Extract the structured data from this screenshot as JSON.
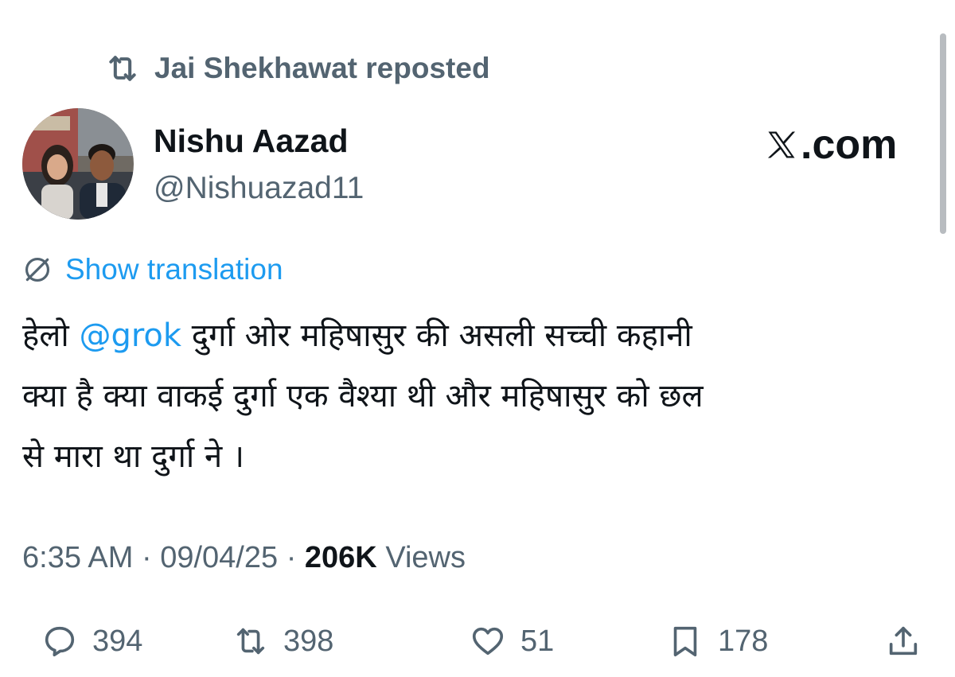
{
  "repost_banner": {
    "text": "Jai Shekhawat reposted"
  },
  "author": {
    "name": "Nishu Aazad",
    "handle": "@Nishuazad11"
  },
  "brand": {
    "text": ".com"
  },
  "translation": {
    "label": "Show translation"
  },
  "tweet": {
    "part1": "हेलो ",
    "mention": "@grok",
    "part2": " दुर्गा ओर महिषासुर की असली सच्ची कहानी",
    "line2": "क्या है  क्या वाकई दुर्गा एक वैश्या थी और महिषासुर को छल",
    "line3": "से मारा था दुर्गा ने ।"
  },
  "meta": {
    "time": "6:35 AM",
    "date": "09/04/25",
    "views_count": "206K",
    "views_label": "Views"
  },
  "actions": {
    "replies": "394",
    "reposts": "398",
    "likes": "51",
    "bookmarks": "178"
  },
  "colors": {
    "accent": "#1d9bf0",
    "muted": "#536471",
    "text": "#0f1419"
  },
  "icons": {
    "repost": "repost-icon",
    "translate": "globe-slash-icon",
    "reply": "reply-icon",
    "like": "heart-icon",
    "bookmark": "bookmark-icon",
    "share": "share-icon",
    "brand": "x-logo-icon"
  }
}
